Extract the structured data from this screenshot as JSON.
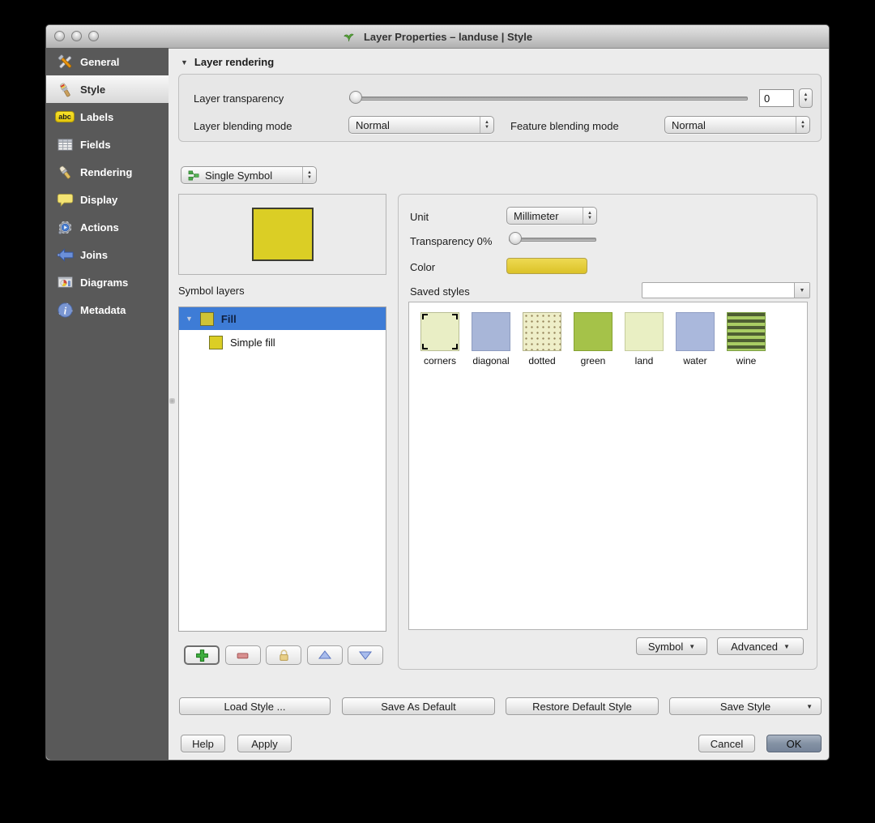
{
  "window": {
    "title": "Layer Properties – landuse | Style"
  },
  "icons": {
    "disclosure_down": "▼",
    "stepper_up": "▲",
    "stepper_down": "▼",
    "menu_arrow": "▼"
  },
  "sidebar": {
    "items": [
      {
        "label": "General"
      },
      {
        "label": "Style"
      },
      {
        "label": "Labels"
      },
      {
        "label": "Fields"
      },
      {
        "label": "Rendering"
      },
      {
        "label": "Display"
      },
      {
        "label": "Actions"
      },
      {
        "label": "Joins"
      },
      {
        "label": "Diagrams"
      },
      {
        "label": "Metadata"
      }
    ],
    "labels_badge": "abc"
  },
  "layer_rendering": {
    "section_label": "Layer rendering",
    "transparency_label": "Layer transparency",
    "transparency_value": "0",
    "layer_blending_label": "Layer blending mode",
    "layer_blending_value": "Normal",
    "feature_blending_label": "Feature blending mode",
    "feature_blending_value": "Normal"
  },
  "renderer": {
    "selected": "Single Symbol"
  },
  "symbol": {
    "symbol_layers_label": "Symbol layers",
    "tree": [
      {
        "label": "Fill"
      },
      {
        "label": "Simple fill"
      }
    ],
    "fill_color": "#dbce25",
    "selection_color": "#3e7cd6"
  },
  "properties": {
    "unit_label": "Unit",
    "unit_value": "Millimeter",
    "transparency_label": "Transparency 0%",
    "color_label": "Color",
    "color_value": "#decb2e",
    "saved_styles_label": "Saved styles",
    "saved_styles_value": ""
  },
  "styles": [
    {
      "label": "corners",
      "color": "#e9eec5"
    },
    {
      "label": "diagonal",
      "color": "#a8b6d8"
    },
    {
      "label": "dotted",
      "color": "#eeeec8"
    },
    {
      "label": "green",
      "color": "#a5c249"
    },
    {
      "label": "land",
      "color": "#e9efc3"
    },
    {
      "label": "water",
      "color": "#aab8dc"
    },
    {
      "label": "wine",
      "color": "#a9cc64"
    }
  ],
  "buttons": {
    "symbol": "Symbol",
    "advanced": "Advanced",
    "load_style": "Load Style ...",
    "save_as_default": "Save As Default",
    "restore_default": "Restore Default Style",
    "save_style": "Save Style",
    "help": "Help",
    "apply": "Apply",
    "cancel": "Cancel",
    "ok": "OK"
  }
}
